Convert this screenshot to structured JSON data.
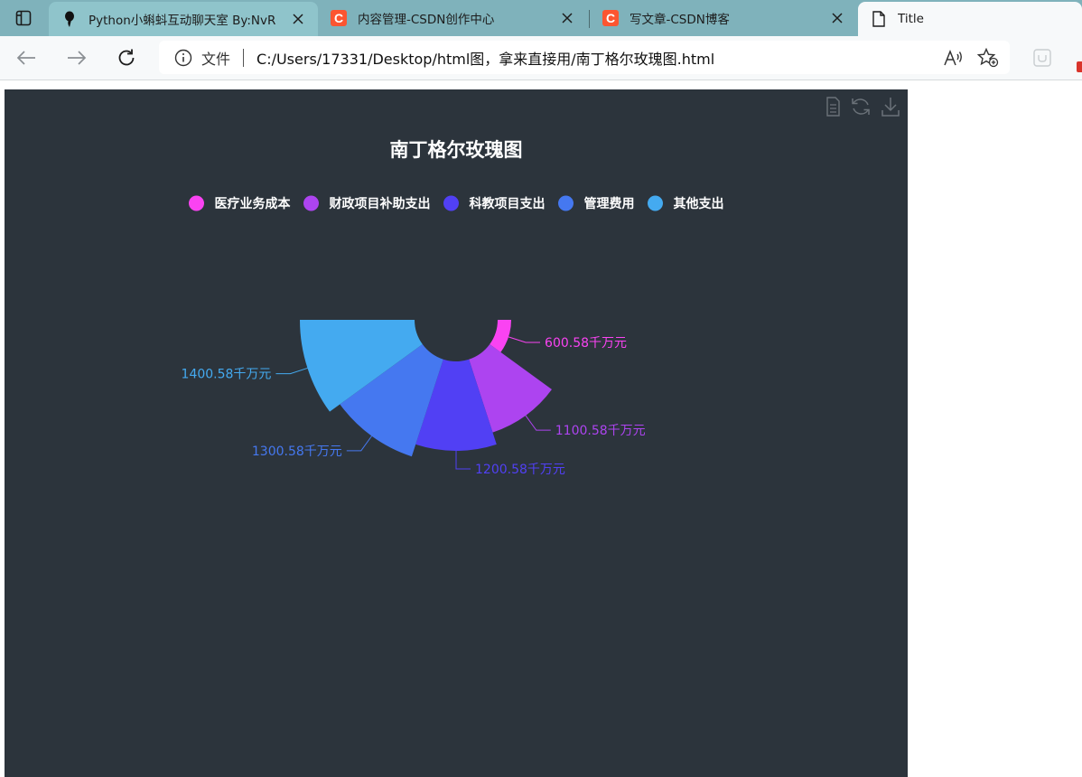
{
  "browser": {
    "tabs": [
      {
        "title": "Python小蝌蚪互动聊天室 By:NvR",
        "icon": "tadpole-icon",
        "state": "inactive"
      },
      {
        "title": "内容管理-CSDN创作中心",
        "icon": "csdn-icon",
        "state": "inactive"
      },
      {
        "title": "写文章-CSDN博客",
        "icon": "csdn-icon",
        "state": "inactive"
      },
      {
        "title": "Title",
        "icon": "page-icon",
        "state": "active"
      }
    ],
    "csdn_logo_letter": "C",
    "address": {
      "scheme_label": "文件",
      "url": "C:/Users/17331/Desktop/html图，拿来直接用/南丁格尔玫瑰图.html"
    }
  },
  "colors": {
    "chart_bg": "#2c343c",
    "tab_strip": "#7fb2bb",
    "toolbar_bg": "#f7f9fa"
  },
  "chart_data": {
    "type": "pie",
    "variant": "nightingale-rose",
    "title": "南丁格尔玫瑰图",
    "legend_position": "top-center",
    "legend": [
      "医疗业务成本",
      "财政项目补助支出",
      "科教项目支出",
      "管理费用",
      "其他支出"
    ],
    "unit": "千万元",
    "series": [
      {
        "name": "医疗业务成本",
        "value": 600.58,
        "label": "600.58千万元",
        "color": "#fa43f2"
      },
      {
        "name": "财政项目补助支出",
        "value": 1100.58,
        "label": "1100.58千万元",
        "color": "#ad44f0"
      },
      {
        "name": "科教项目支出",
        "value": 1200.58,
        "label": "1200.58千万元",
        "color": "#5140f4"
      },
      {
        "name": "管理费用",
        "value": 1300.58,
        "label": "1300.58千万元",
        "color": "#4578f0"
      },
      {
        "name": "其他支出",
        "value": 1400.58,
        "label": "1400.58千万元",
        "color": "#44aaf0"
      }
    ],
    "toolbox": [
      "data-view-icon",
      "restore-icon",
      "save-image-icon"
    ]
  }
}
